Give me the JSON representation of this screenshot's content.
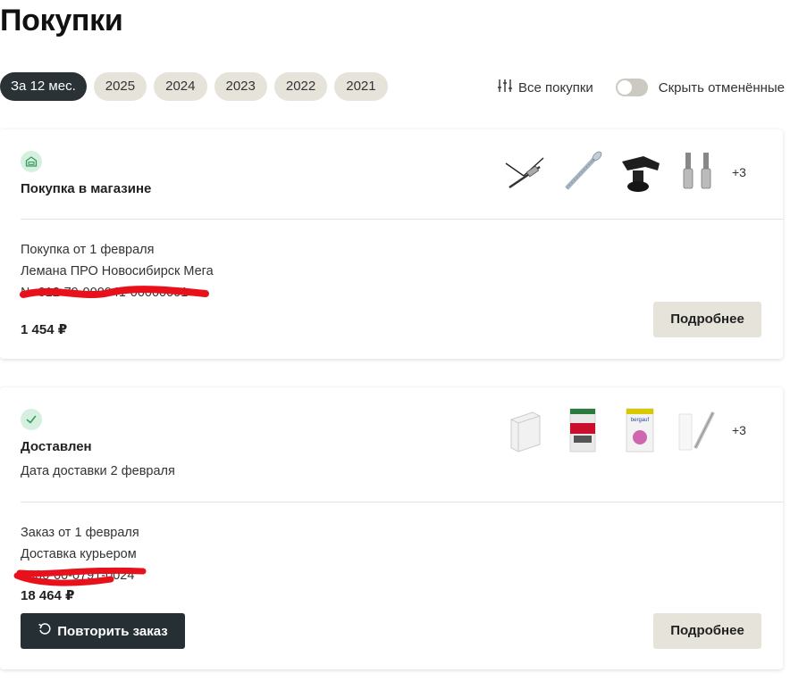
{
  "page": {
    "title": "Покупки"
  },
  "filters": {
    "chips": [
      "За 12 мес.",
      "2025",
      "2024",
      "2023",
      "2022",
      "2021"
    ],
    "active_index": 0,
    "all_purchases_label": "Все покупки",
    "hide_cancelled_label": "Скрыть отменённые",
    "hide_cancelled_on": false
  },
  "orders": [
    {
      "status_icon": "store-icon",
      "heading": "Покупка в магазине",
      "more_count": "+3",
      "line1": "Покупка от 1 февраля",
      "line2": "Лемана ПРО Новосибирск Мега",
      "line3": "№ 012-79-000041-00000001",
      "price": "1 454 ₽",
      "details_label": "Подробнее",
      "thumb_icons": [
        "drill-bit-icon",
        "screw-icon",
        "clamp-icon",
        "socket-bits-icon"
      ]
    },
    {
      "status_icon": "check-icon",
      "heading": "Доставлен",
      "subheading": "Дата доставки 2 февраля",
      "more_count": "+3",
      "line1": "Заказ от 1 февраля",
      "line2": "Доставка курьером",
      "line3": "0000-00-0791-0024",
      "price": "18 464 ₽",
      "details_label": "Подробнее",
      "repeat_label": "Повторить заказ",
      "thumb_icons": [
        "block-icon",
        "cement-bag-icon",
        "plaster-bag-icon",
        "rod-icon"
      ]
    }
  ],
  "colors": {
    "chip_bg": "#e6e3da",
    "chip_active_bg": "#2a3236",
    "status_bg": "#d6f0e0",
    "status_fg": "#3a9a5c",
    "primary_btn": "#262f33",
    "redaction": "#e8101a"
  }
}
